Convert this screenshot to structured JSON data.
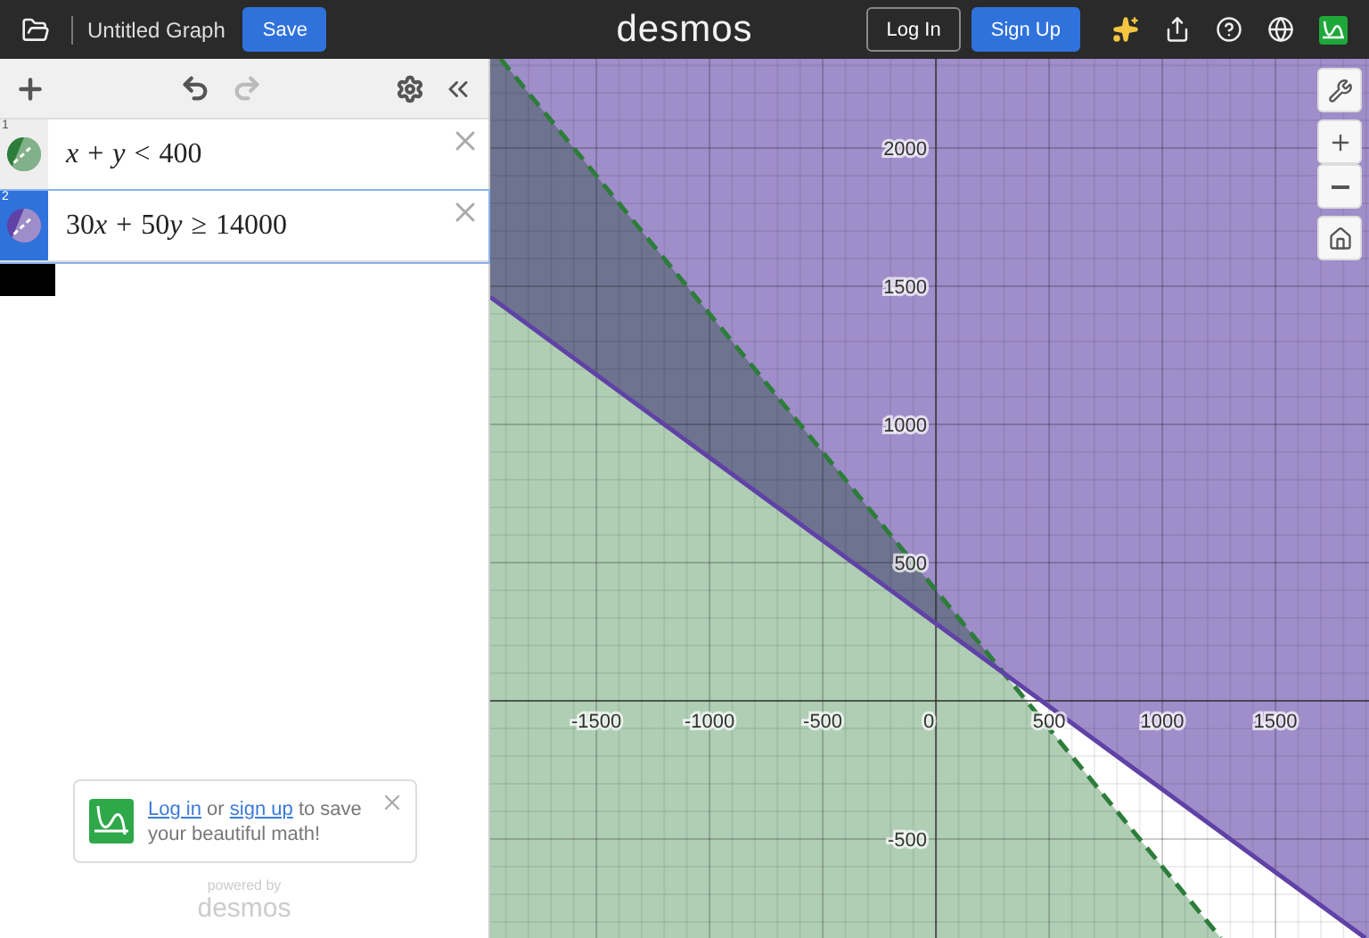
{
  "header": {
    "title": "Untitled Graph",
    "save": "Save",
    "logo": "desmos",
    "login": "Log In",
    "signup": "Sign Up"
  },
  "expressions": [
    {
      "index": "1",
      "parts": [
        {
          "kind": "variable",
          "text": "x"
        },
        {
          "kind": "operator",
          "text": "+"
        },
        {
          "kind": "variable",
          "text": "y"
        },
        {
          "kind": "operator",
          "text": "<"
        },
        {
          "kind": "number",
          "text": "400"
        }
      ],
      "color": "#2d7d3a",
      "selected": false
    },
    {
      "index": "2",
      "parts": [
        {
          "kind": "number",
          "text": "30"
        },
        {
          "kind": "variable",
          "text": "x"
        },
        {
          "kind": "operator",
          "text": "+"
        },
        {
          "kind": "number",
          "text": "50"
        },
        {
          "kind": "variable",
          "text": "y"
        },
        {
          "kind": "operator",
          "text": "≥"
        },
        {
          "kind": "number",
          "text": "14000"
        }
      ],
      "color": "#6042a6",
      "selected": true
    }
  ],
  "save_prompt": {
    "login_link": "Log in",
    "joiner": "or",
    "signup_link": "sign up",
    "rest": "to save your beautiful math!"
  },
  "footer": {
    "powered": "powered by",
    "brand": "desmos"
  },
  "graph": {
    "chart_data": {
      "type": "line",
      "grid": true,
      "x": [
        -1969,
        -1923,
        1258,
        1897
      ],
      "xlim": [
        -1969,
        1913
      ],
      "ylim": [
        -858,
        2323
      ],
      "xticks": [
        {
          "value": -1500,
          "label": "-1500"
        },
        {
          "value": -1000,
          "label": "-1000"
        },
        {
          "value": -500,
          "label": "-500"
        },
        {
          "value": 0,
          "label": "0"
        },
        {
          "value": 500,
          "label": "500"
        },
        {
          "value": 1000,
          "label": "1000"
        },
        {
          "value": 1500,
          "label": "1500"
        }
      ],
      "yticks": [
        {
          "value": -500,
          "label": "-500"
        },
        {
          "value": 500,
          "label": "500"
        },
        {
          "value": 1000,
          "label": "1000"
        },
        {
          "value": 1500,
          "label": "1500"
        },
        {
          "value": 2000,
          "label": "2000"
        }
      ],
      "series": [
        {
          "color": "#2d7d3a",
          "line_style": "dashed",
          "values": [
            null,
            2323,
            -858,
            null
          ]
        },
        {
          "color": "#6042a6",
          "line_style": "solid",
          "values": [
            1461,
            1434,
            -475,
            -858
          ]
        }
      ]
    }
  }
}
